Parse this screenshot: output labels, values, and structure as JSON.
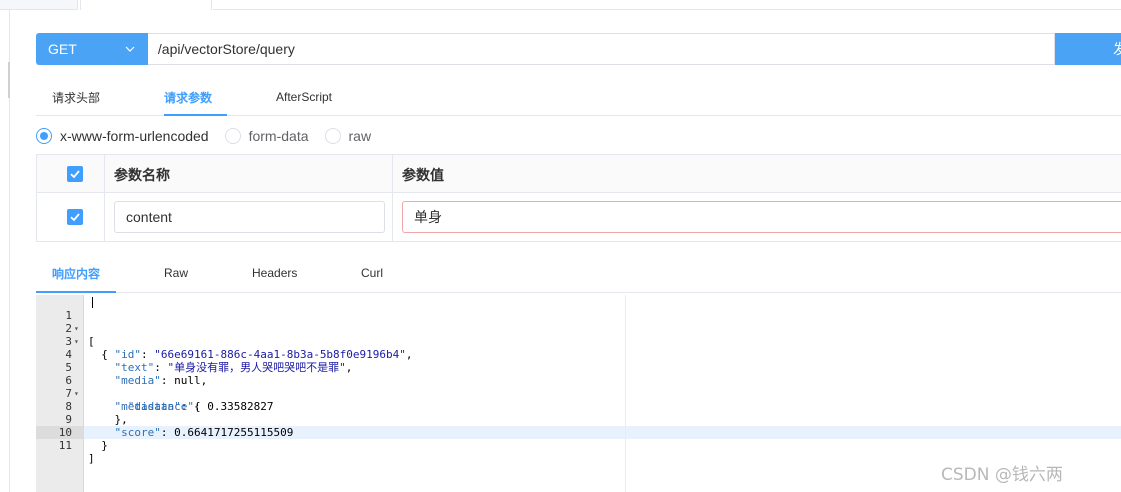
{
  "request": {
    "method": "GET",
    "url": "/api/vectorStore/query",
    "send_label": "发"
  },
  "request_tabs": [
    {
      "label": "请求头部",
      "active": false
    },
    {
      "label": "请求参数",
      "active": true
    },
    {
      "label": "AfterScript",
      "active": false
    }
  ],
  "body_types": [
    {
      "label": "x-www-form-urlencoded",
      "checked": true
    },
    {
      "label": "form-data",
      "checked": false
    },
    {
      "label": "raw",
      "checked": false
    }
  ],
  "params_table": {
    "headers": {
      "name": "参数名称",
      "value": "参数值"
    },
    "rows": [
      {
        "checked": true,
        "name": "content",
        "value": "单身"
      }
    ]
  },
  "response_tabs": [
    {
      "label": "响应内容",
      "active": true
    },
    {
      "label": "Raw",
      "active": false
    },
    {
      "label": "Headers",
      "active": false
    },
    {
      "label": "Curl",
      "active": false
    }
  ],
  "response": {
    "line_numbers": [
      "1",
      "2",
      "3",
      "4",
      "5",
      "6",
      "7",
      "8",
      "9",
      "10",
      "11"
    ],
    "fold_markers": {
      "1": "▾",
      "2": "▾",
      "6": "▾"
    },
    "lines": {
      "l1": "[",
      "l2": "  {",
      "l3_key": "\"id\"",
      "l3_val": "\"66e69161-886c-4aa1-8b3a-5b8f0e9196b4\"",
      "l4_key": "\"text\"",
      "l4_val": "\"单身没有罪，男人哭吧哭吧不是罪\"",
      "l5_key": "\"media\"",
      "l5_val": "null",
      "l6_key": "\"metadata\"",
      "l7_key": "\"distance\"",
      "l7_val": "0.33582827",
      "l8": "    },",
      "l9_key": "\"score\"",
      "l9_val": "0.6641717255115509",
      "l10": "  }",
      "l11": "]"
    }
  },
  "watermark": "CSDN @钱六两",
  "colors": {
    "accent": "#409eff",
    "method_bg": "#4aa3f4",
    "error_border": "#f0a7a7"
  }
}
